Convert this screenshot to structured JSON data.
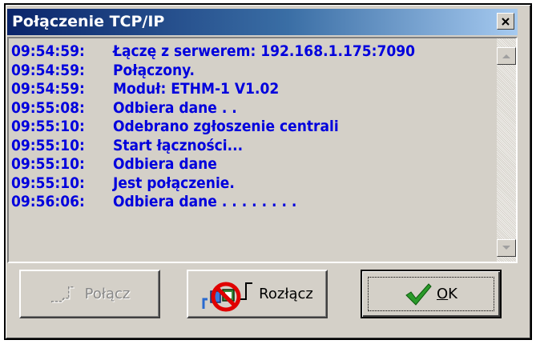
{
  "window": {
    "title": "Połączenie TCP/IP",
    "close_glyph": "×"
  },
  "log": [
    {
      "time": "09:54:59:",
      "message": "Łączę z serwerem: 192.168.1.175:7090"
    },
    {
      "time": "09:54:59:",
      "message": "Połączony."
    },
    {
      "time": "09:54:59:",
      "message": "Moduł: ETHM-1 V1.02"
    },
    {
      "time": "09:55:08:",
      "message": "Odbiera dane  . ."
    },
    {
      "time": "09:55:10:",
      "message": "Odebrano zgłoszenie centrali"
    },
    {
      "time": "09:55:10:",
      "message": "Start łączności..."
    },
    {
      "time": "09:55:10:",
      "message": "Odbiera dane"
    },
    {
      "time": "09:55:10:",
      "message": "Jest połączenie."
    },
    {
      "time": "09:56:06:",
      "message": "Odbiera dane . . . . . . . ."
    }
  ],
  "buttons": {
    "connect": {
      "label": "Połącz",
      "icon": "connect-plug-icon",
      "enabled": false
    },
    "disconnect": {
      "label": "Rozłącz",
      "icon": "disconnect-plug-icon",
      "enabled": true
    },
    "ok": {
      "label_first": "O",
      "label_rest": "K",
      "icon": "checkmark-icon",
      "default": true
    }
  },
  "colors": {
    "log_text": "#0000dd",
    "title_start": "#0a246a",
    "title_end": "#a6caf0",
    "checkmark": "#2a9a2a",
    "forbidden": "#e00000"
  }
}
